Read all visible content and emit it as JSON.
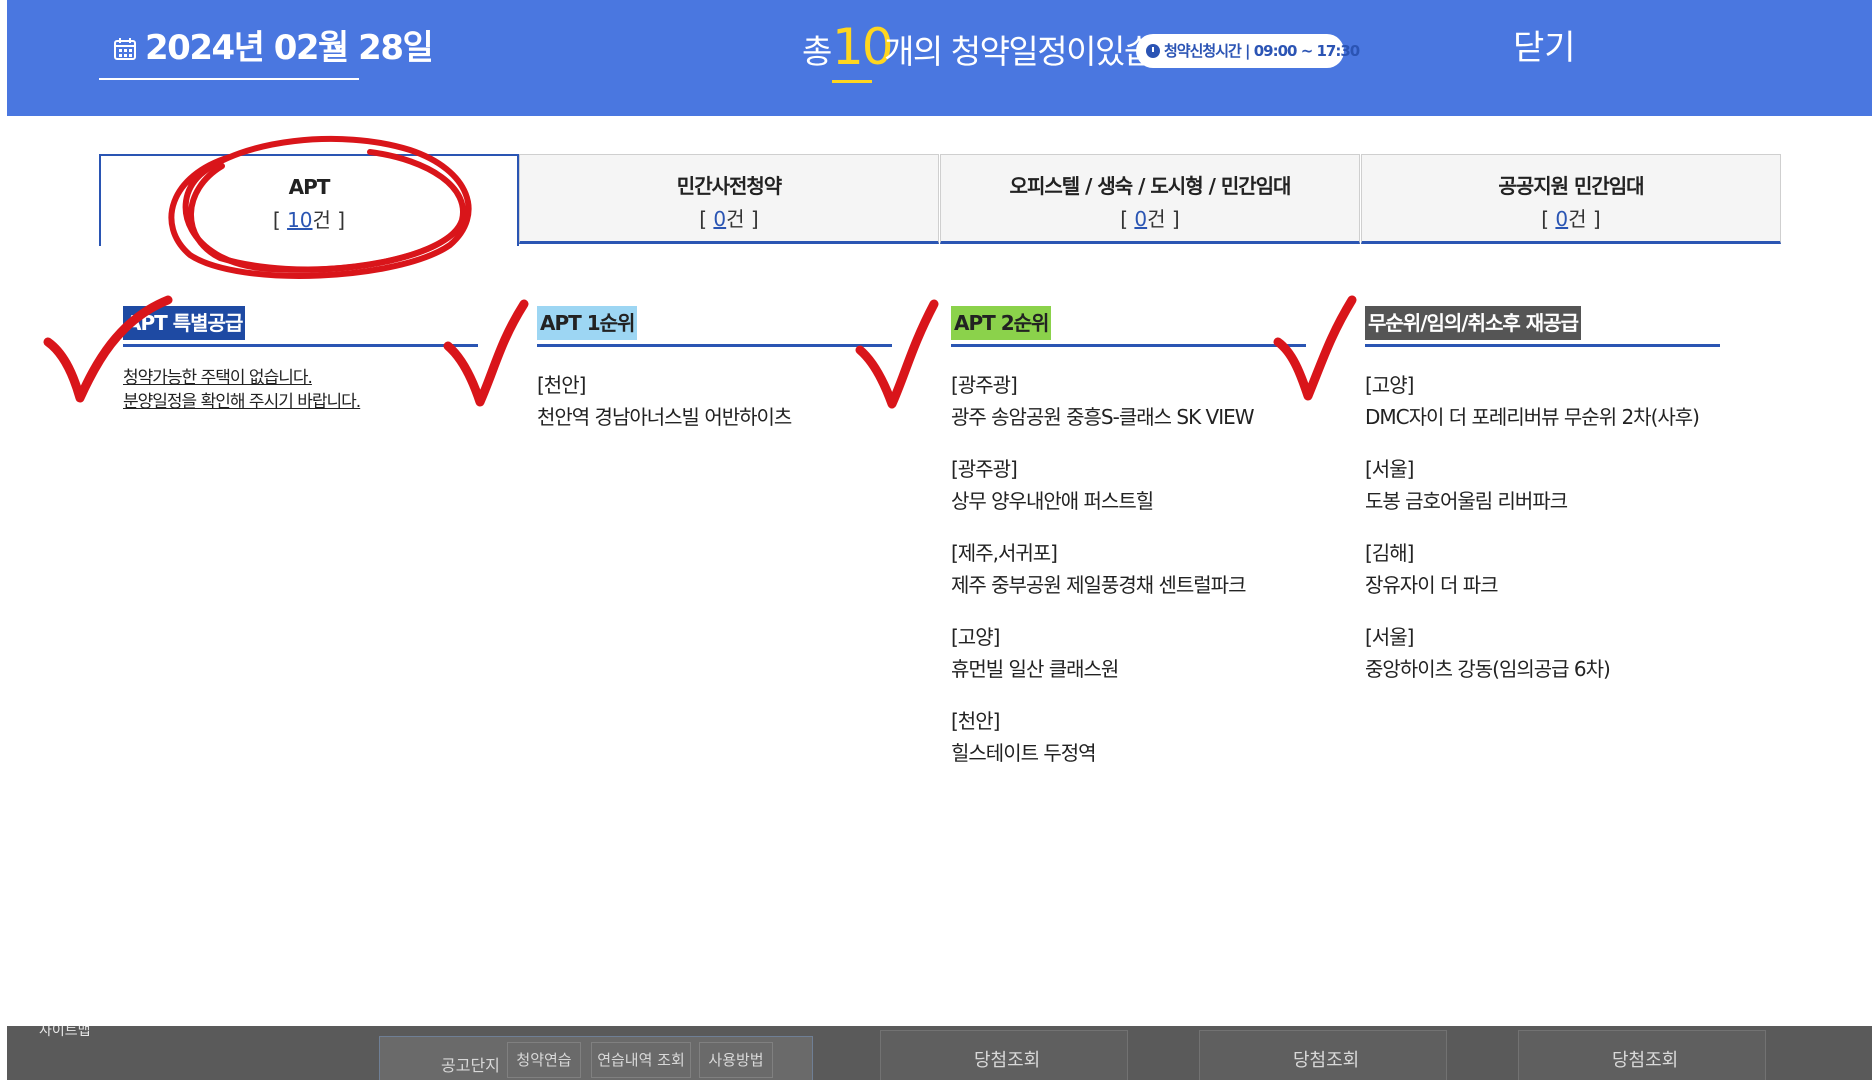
{
  "header": {
    "date": "2024년 02월 28일",
    "caret": "▾",
    "summary_prefix": "총",
    "total_count": "10",
    "summary_suffix": "개의 청약일정이있습니다.",
    "time_label": "청약신청시간 | 09:00 ~ 17:30",
    "close_label": "닫기",
    "background_color": "#4a77e0",
    "accent_color": "#ffd61f"
  },
  "tabs": [
    {
      "label": "APT",
      "count": "10",
      "unit": "건"
    },
    {
      "label": "민간사전청약",
      "count": "0",
      "unit": "건"
    },
    {
      "label": "오피스텔 / 생숙 / 도시형 / 민간임대",
      "count": "0",
      "unit": "건"
    },
    {
      "label": "공공지원 민간임대",
      "count": "0",
      "unit": "건"
    }
  ],
  "columns": {
    "special": {
      "title": "APT 특별공급",
      "color": "#1e4aa3",
      "empty_line1": "청약가능한 주택이 없습니다.",
      "empty_line2": "분양일정을 확인해 주시기 바랍니다."
    },
    "first": {
      "title": "APT 1순위",
      "color": "#9dd6f3",
      "items": [
        {
          "region": "[천안]",
          "name": "천안역 경남아너스빌 어반하이츠"
        }
      ]
    },
    "second": {
      "title": "APT 2순위",
      "color": "#8bd24b",
      "items": [
        {
          "region": "[광주광]",
          "name": "광주 송암공원 중흥S-클래스 SK VIEW"
        },
        {
          "region": "[광주광]",
          "name": "상무 양우내안애 퍼스트힐"
        },
        {
          "region": "[제주,서귀포]",
          "name": "제주 중부공원 제일풍경채 센트럴파크"
        },
        {
          "region": "[고양]",
          "name": "휴먼빌 일산 클래스원"
        },
        {
          "region": "[천안]",
          "name": "힐스테이트 두정역"
        }
      ]
    },
    "reissue": {
      "title": "무순위/임의/취소후 재공급",
      "color": "#555555",
      "items": [
        {
          "region": "[고양]",
          "name": "DMC자이 더 포레리버뷰 무순위 2차(사후)"
        },
        {
          "region": "[서울]",
          "name": "도봉 금호어울림 리버파크"
        },
        {
          "region": "[김해]",
          "name": "장유자이 더 파크"
        },
        {
          "region": "[서울]",
          "name": "중앙하이츠 강동(임의공급 6차)"
        }
      ]
    }
  },
  "footer": {
    "sitemap": "사이트맵",
    "sub_label": "공고단지",
    "buttons": [
      "청약연습",
      "연습내역 조회",
      "사용방법"
    ],
    "winner_labels": [
      "당첨조회",
      "당첨조회",
      "당첨조회"
    ]
  }
}
